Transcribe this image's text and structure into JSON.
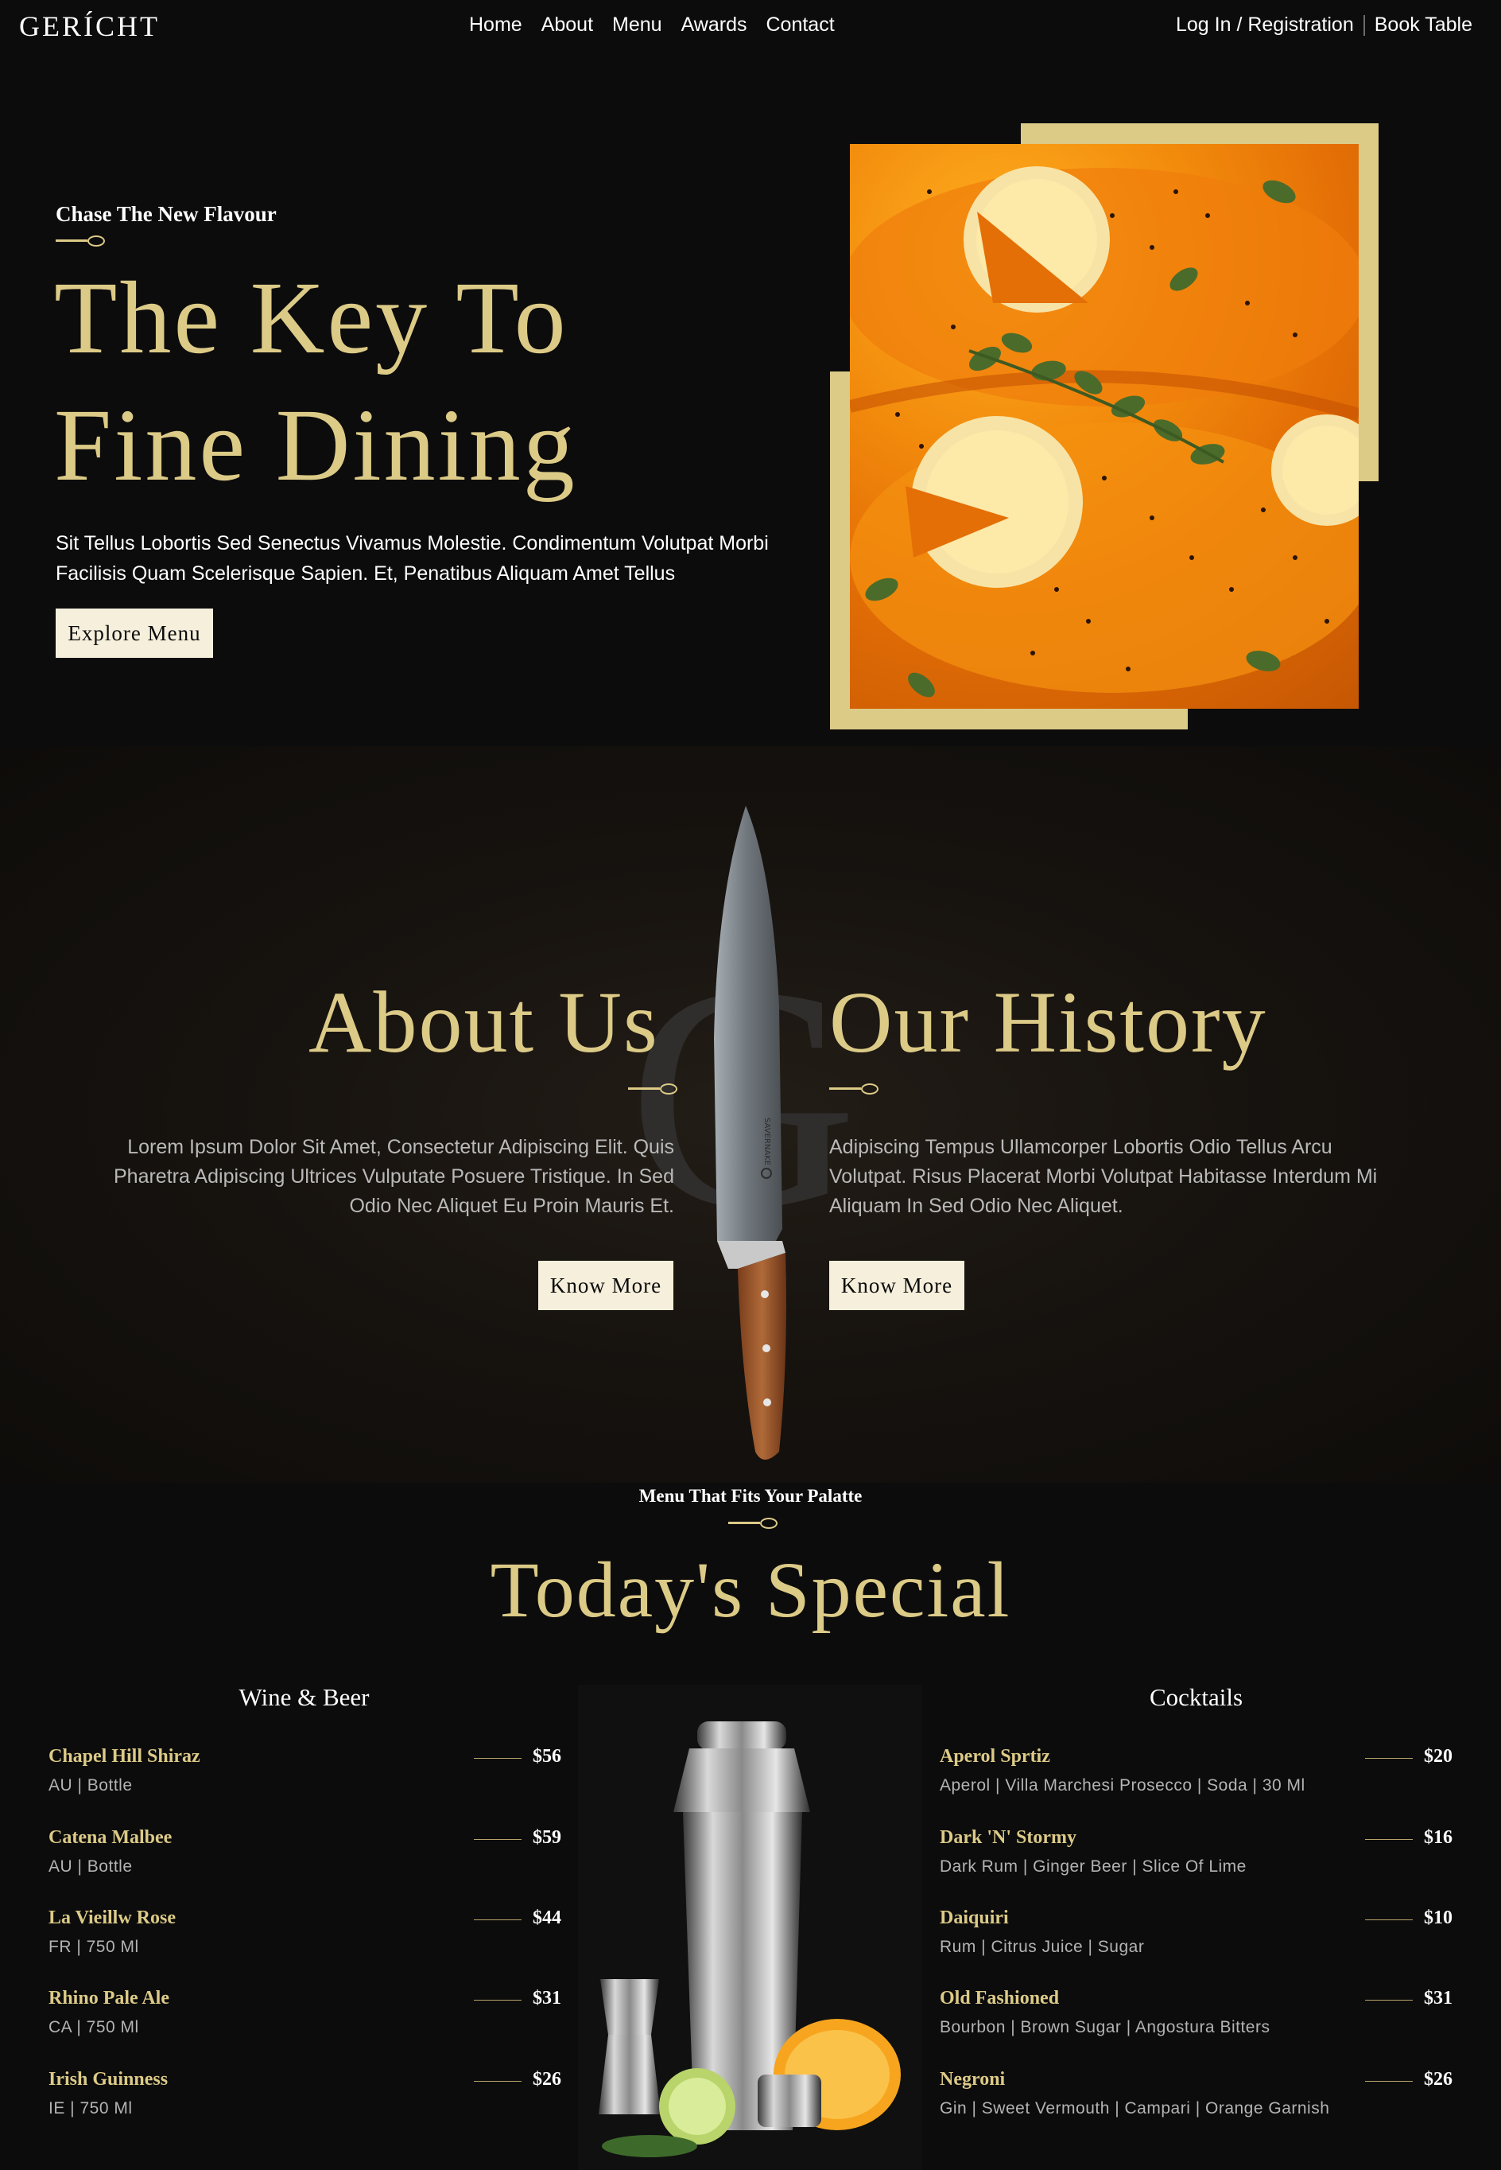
{
  "navbar": {
    "logo": "GERÍCHT",
    "links": [
      "Home",
      "About",
      "Menu",
      "Awards",
      "Contact"
    ],
    "login": "Log In / Registration",
    "book": "Book Table"
  },
  "hero": {
    "subtitle": "Chase The New Flavour",
    "title_line1": "The Key To",
    "title_line2": "Fine Dining",
    "description": "Sit Tellus Lobortis Sed Senectus Vivamus Molestie. Condimentum Volutpat Morbi Facilisis Quam Scelerisque Sapien. Et, Penatibus Aliquam Amet Tellus",
    "button": "Explore Menu"
  },
  "about": {
    "watermark": "G",
    "knife_brand": "SAVERNAKE",
    "about_title": "About Us",
    "about_text": "Lorem Ipsum Dolor Sit Amet, Consectetur Adipiscing Elit. Quis Pharetra Adipiscing Ultrices Vulputate Posuere Tristique. In Sed Odio Nec Aliquet Eu Proin Mauris Et.",
    "about_button": "Know More",
    "history_title": "Our History",
    "history_text": "Adipiscing Tempus Ullamcorper Lobortis Odio Tellus Arcu Volutpat. Risus Placerat Morbi Volutpat Habitasse Interdum Mi Aliquam In Sed Odio Nec Aliquet.",
    "history_button": "Know More"
  },
  "special": {
    "subtitle": "Menu That Fits Your Palatte",
    "title": "Today's Special",
    "wine": {
      "heading": "Wine & Beer",
      "items": [
        {
          "name": "Chapel Hill Shiraz",
          "price": "$56",
          "tags": "AU | Bottle"
        },
        {
          "name": "Catena Malbee",
          "price": "$59",
          "tags": "AU | Bottle"
        },
        {
          "name": "La Vieillw Rose",
          "price": "$44",
          "tags": "FR | 750 Ml"
        },
        {
          "name": "Rhino Pale Ale",
          "price": "$31",
          "tags": "CA | 750 Ml"
        },
        {
          "name": "Irish Guinness",
          "price": "$26",
          "tags": "IE | 750 Ml"
        }
      ]
    },
    "cocktails": {
      "heading": "Cocktails",
      "items": [
        {
          "name": "Aperol Sprtiz",
          "price": "$20",
          "tags": "Aperol | Villa Marchesi Prosecco | Soda | 30 Ml"
        },
        {
          "name": "Dark 'N' Stormy",
          "price": "$16",
          "tags": "Dark Rum | Ginger Beer | Slice Of Lime"
        },
        {
          "name": "Daiquiri",
          "price": "$10",
          "tags": "Rum | Citrus Juice | Sugar"
        },
        {
          "name": "Old Fashioned",
          "price": "$31",
          "tags": "Bourbon | Brown Sugar | Angostura Bitters"
        },
        {
          "name": "Negroni",
          "price": "$26",
          "tags": "Gin | Sweet Vermouth | Campari | Orange Garnish"
        }
      ]
    }
  },
  "colors": {
    "gold": "#dcca87",
    "background": "#0c0c0c",
    "button": "#f5efdb"
  }
}
